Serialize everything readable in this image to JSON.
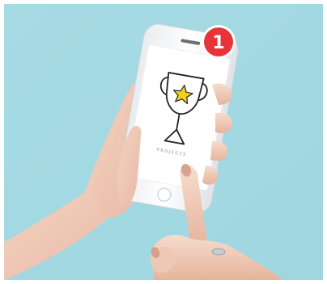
{
  "scene": {
    "background_color": "#a9dde6",
    "phone_color": "#ffffff",
    "badge_color": "#e8333a",
    "trophy_star_color": "#f2d019"
  },
  "notification": {
    "count": "1"
  },
  "screen": {
    "caption": "PROJECTS",
    "icon": "trophy-icon"
  }
}
